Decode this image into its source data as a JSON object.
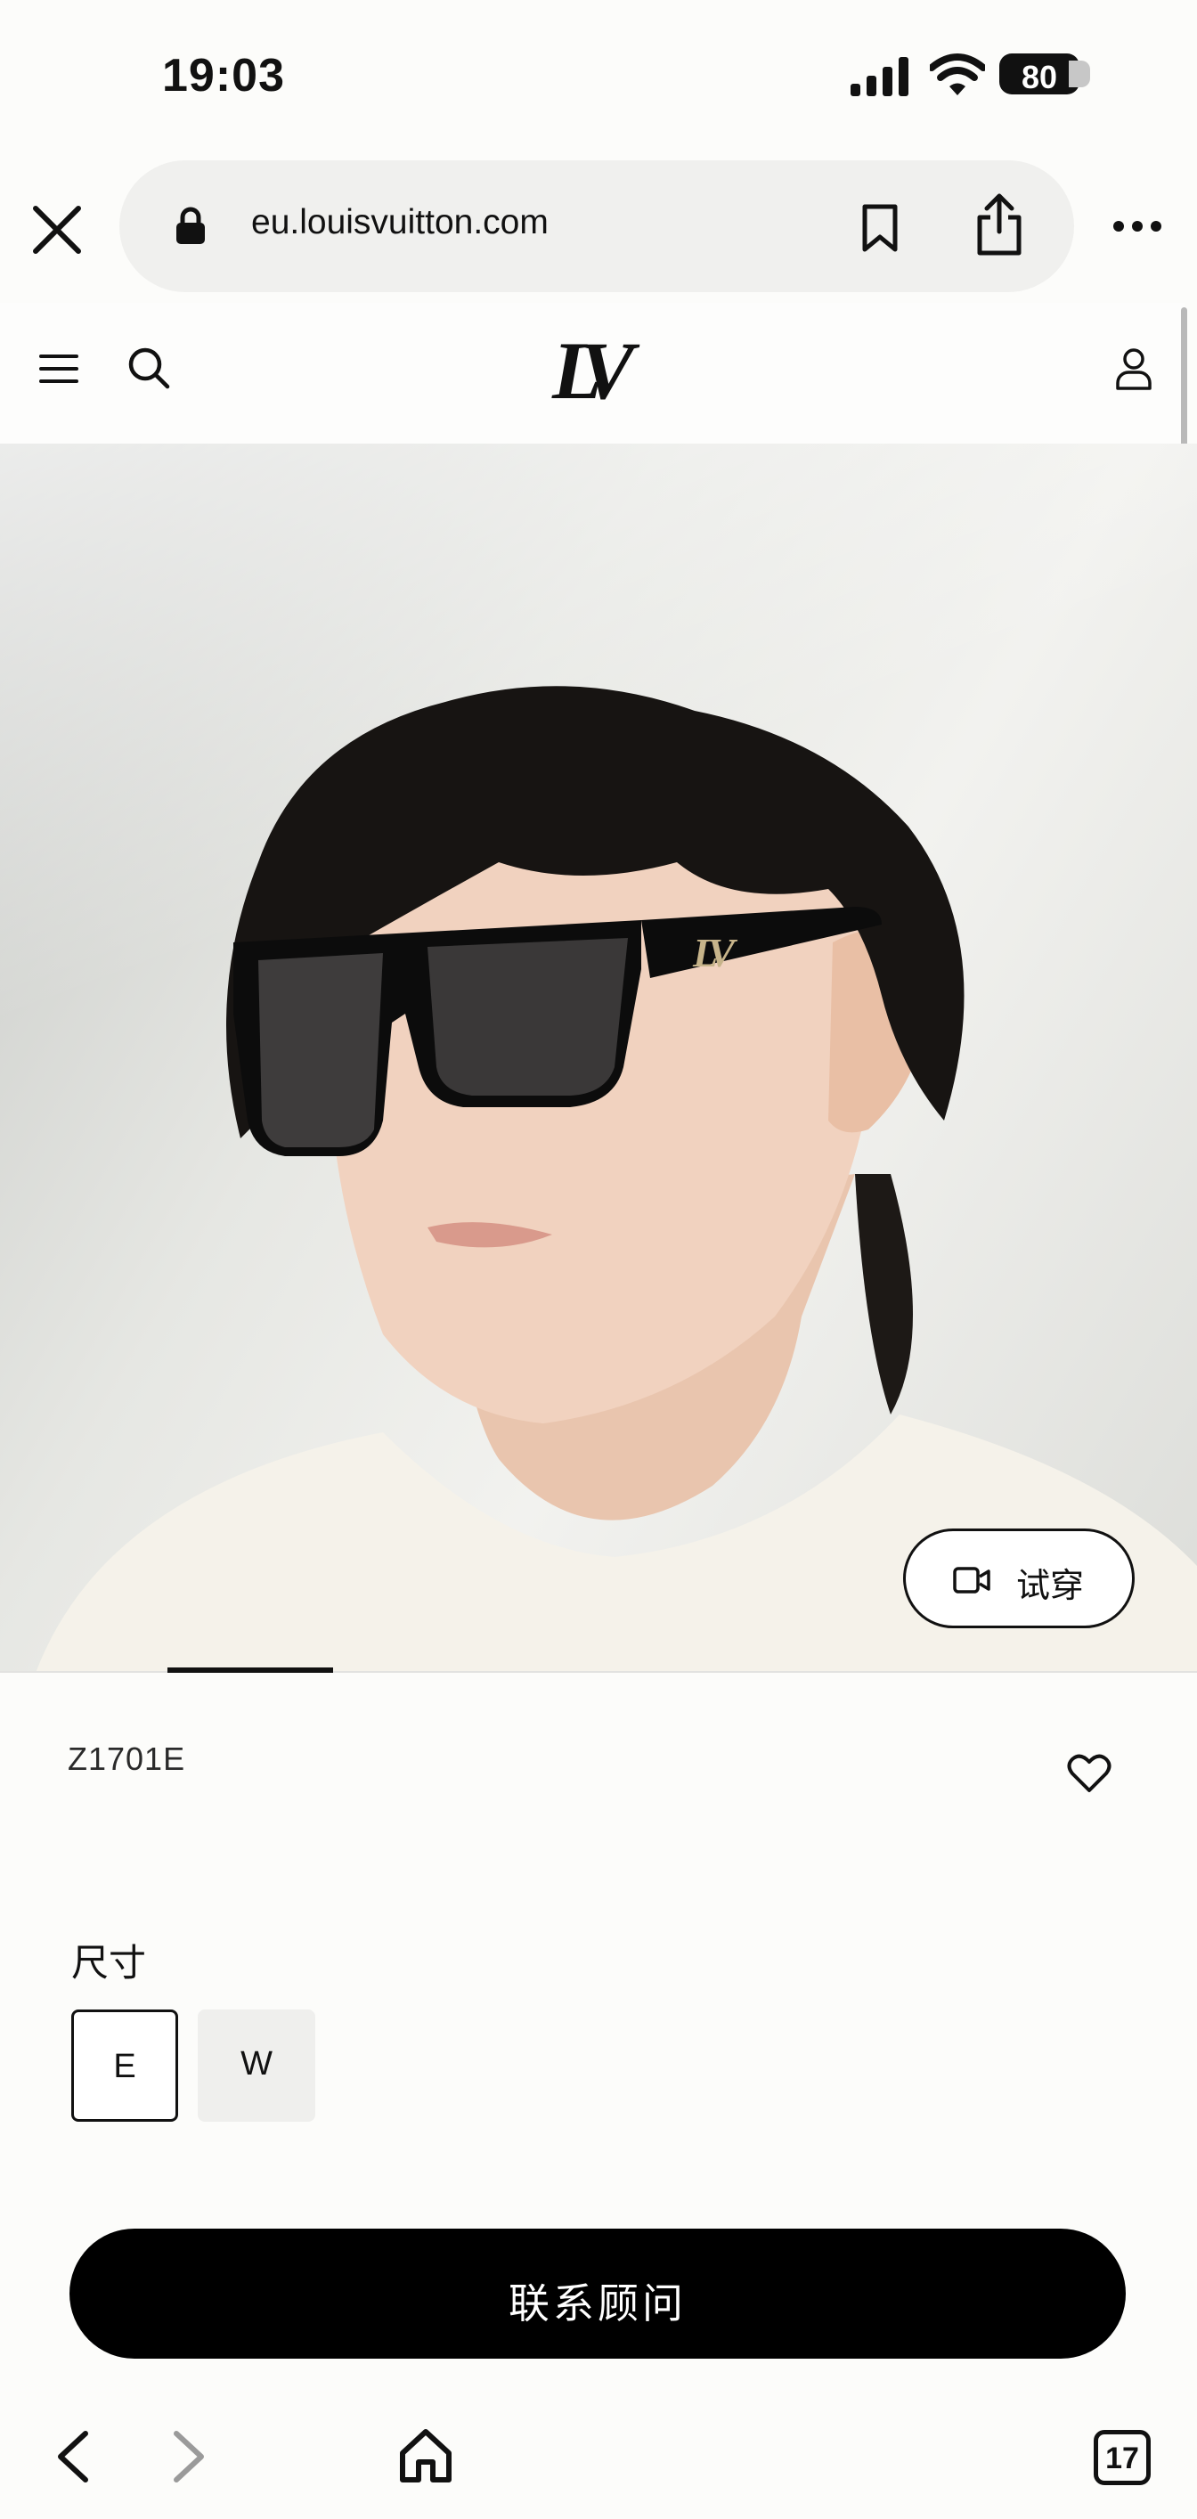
{
  "status_bar": {
    "time": "19:03",
    "battery": "80",
    "icons": [
      "signal-icon",
      "wifi-icon",
      "battery-icon"
    ]
  },
  "browser": {
    "url": "eu.louisvuitton.com",
    "icons": [
      "close-icon",
      "lock-icon",
      "bookmark-icon",
      "share-icon",
      "more-icon"
    ]
  },
  "site_header": {
    "logo": "LV",
    "icons": [
      "menu-icon",
      "search-icon",
      "account-icon"
    ]
  },
  "hero": {
    "try_on_label": "试穿",
    "icons": [
      "video-icon"
    ]
  },
  "product": {
    "sku": "Z1701E",
    "size_label": "尺寸",
    "sizes": [
      "E",
      "W"
    ],
    "selected_size": "E",
    "cta_label": "联系顾问"
  },
  "bottom_nav": {
    "tabs_count": "17",
    "icons": [
      "back-icon",
      "forward-icon",
      "home-icon",
      "tabs-icon"
    ]
  },
  "colors": {
    "background": "#fcfcfa",
    "cta": "#000000",
    "url_pill": "#f0f0ee"
  }
}
